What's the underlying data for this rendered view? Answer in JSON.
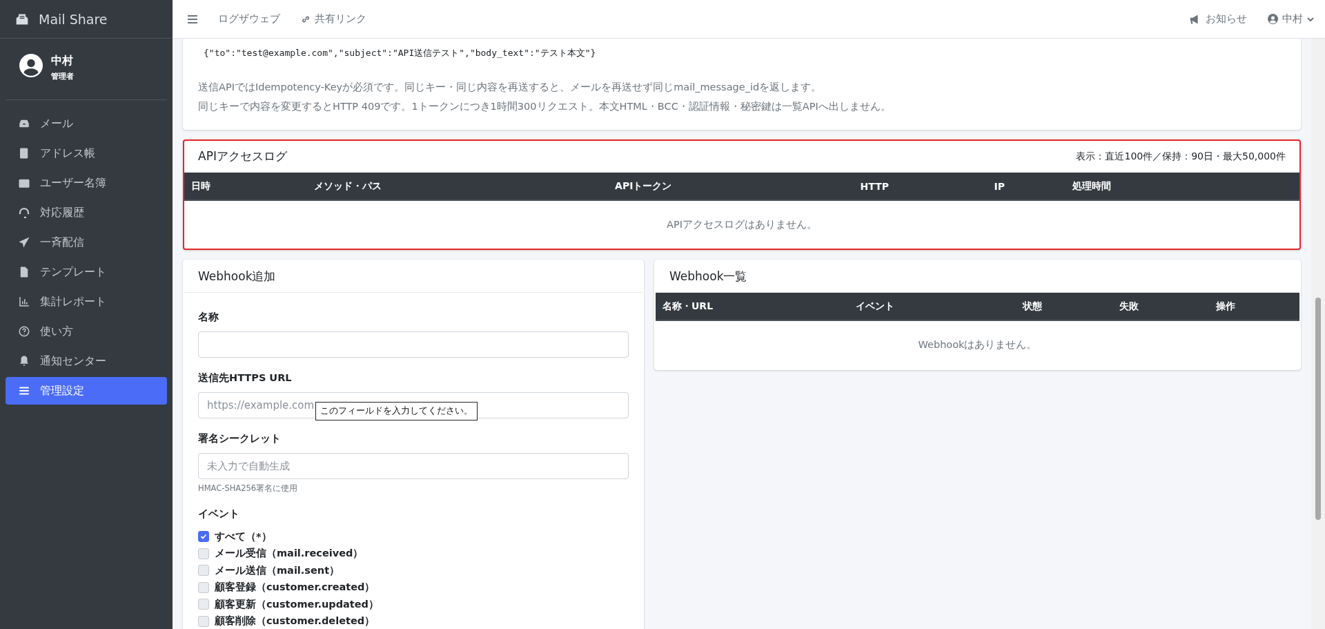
{
  "brand": {
    "name": "Mail Share"
  },
  "user": {
    "name": "中村",
    "role": "管理者"
  },
  "sidebar": {
    "items": [
      {
        "label": "メール",
        "selected": false
      },
      {
        "label": "アドレス帳",
        "selected": false
      },
      {
        "label": "ユーザー名簿",
        "selected": false
      },
      {
        "label": "対応履歴",
        "selected": false
      },
      {
        "label": "一斉配信",
        "selected": false
      },
      {
        "label": "テンプレート",
        "selected": false
      },
      {
        "label": "集計レポート",
        "selected": false
      },
      {
        "label": "使い方",
        "selected": false
      },
      {
        "label": "通知センター",
        "selected": false
      },
      {
        "label": "管理設定",
        "selected": true
      }
    ]
  },
  "topbar": {
    "links": [
      "ログザウェブ",
      "共有リンク"
    ],
    "notice": "お知らせ",
    "user": "中村"
  },
  "api_info": {
    "code": "{\"to\":\"test@example.com\",\"subject\":\"API送信テスト\",\"body_text\":\"テスト本文\"}",
    "lines": [
      "送信APIではIdempotency-Keyが必須です。同じキー・同じ内容を再送すると、メールを再送せず同じmail_message_idを返します。",
      "同じキーで内容を変更するとHTTP 409です。1トークンにつき1時間300リクエスト。本文HTML・BCC・認証情報・秘密鍵は一覧APIへ出しません。"
    ]
  },
  "access_log": {
    "title": "APIアクセスログ",
    "highlighted": true,
    "meta": "表示：直近100件／保持：90日・最大50,000件",
    "columns": [
      "日時",
      "メソッド・パス",
      "APIトークン",
      "HTTP",
      "IP",
      "処理時間"
    ],
    "empty": "APIアクセスログはありません。"
  },
  "webhook_form": {
    "title": "Webhook追加",
    "fields": [
      {
        "label": "名称"
      },
      {
        "label": "送信先HTTPS URL",
        "placeholder": "https://example.com"
      },
      {
        "label": "署名シークレット",
        "placeholder": "未入力で自動生成",
        "help": "HMAC-SHA256署名に使用"
      }
    ],
    "tooltip": "このフィールドを入力してください。",
    "events_label": "イベント",
    "events": [
      {
        "label": "すべて（*）",
        "checked": true
      },
      {
        "label": "メール受信（mail.received）",
        "checked": false
      },
      {
        "label": "メール送信（mail.sent）",
        "checked": false
      },
      {
        "label": "顧客登録（customer.created）",
        "checked": false
      },
      {
        "label": "顧客更新（customer.updated）",
        "checked": false
      },
      {
        "label": "顧客削除（customer.deleted）",
        "checked": false
      }
    ]
  },
  "webhook_list": {
    "title": "Webhook一覧",
    "columns": [
      "名称・URL",
      "イベント",
      "状態",
      "失敗",
      "操作"
    ],
    "empty": "Webhookはありません。"
  }
}
